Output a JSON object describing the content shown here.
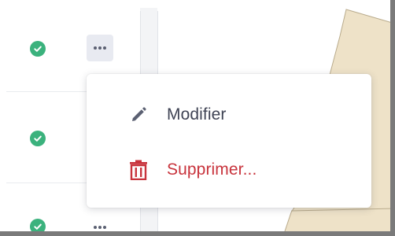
{
  "menu": {
    "items": [
      {
        "label": "Modifier",
        "icon": "pencil-icon"
      },
      {
        "label": "Supprimer...",
        "icon": "trash-icon"
      }
    ]
  },
  "rows": [
    {
      "status": "check-circle-icon"
    },
    {
      "status": "check-circle-icon"
    },
    {
      "status": "check-circle-icon"
    }
  ],
  "colors": {
    "status_green": "#3bb27d",
    "danger_red": "#c8333c",
    "text_dark": "#3f4354",
    "map_fill": "#eee2c8"
  }
}
